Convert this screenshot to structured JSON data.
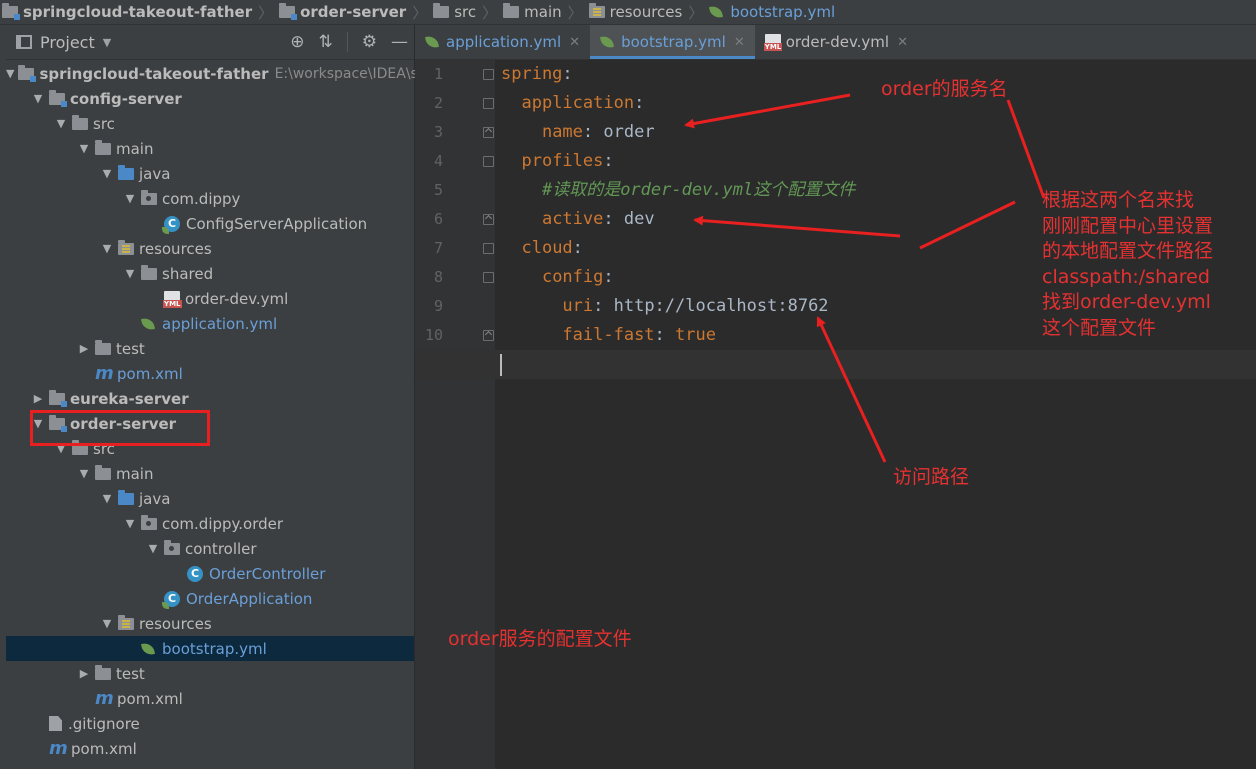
{
  "breadcrumb": [
    "springcloud-takeout-father",
    "order-server",
    "src",
    "main",
    "resources",
    "bootstrap.yml"
  ],
  "project_panel": {
    "title": "Project",
    "tree": [
      {
        "label": "springcloud-takeout-father",
        "extra": "E:\\workspace\\IDEA\\s",
        "level": 0,
        "expanded": true,
        "icon": "module-folder-icon",
        "bold": true
      },
      {
        "label": "config-server",
        "level": 1,
        "expanded": true,
        "icon": "module-folder-icon",
        "bold": true
      },
      {
        "label": "src",
        "level": 2,
        "expanded": true,
        "icon": "folder-icon"
      },
      {
        "label": "main",
        "level": 3,
        "expanded": true,
        "icon": "folder-icon"
      },
      {
        "label": "java",
        "level": 4,
        "expanded": true,
        "icon": "source-folder-icon"
      },
      {
        "label": "com.dippy",
        "level": 5,
        "expanded": true,
        "icon": "package-icon"
      },
      {
        "label": "ConfigServerApplication",
        "level": 6,
        "icon": "spring-boot-class-icon"
      },
      {
        "label": "resources",
        "level": 4,
        "expanded": true,
        "icon": "resources-folder-icon"
      },
      {
        "label": "shared",
        "level": 5,
        "expanded": true,
        "icon": "folder-icon"
      },
      {
        "label": "order-dev.yml",
        "level": 6,
        "icon": "yml-file-icon"
      },
      {
        "label": "application.yml",
        "level": 5,
        "icon": "spring-yml-icon",
        "blue": true
      },
      {
        "label": "test",
        "level": 3,
        "expanded": false,
        "icon": "folder-icon"
      },
      {
        "label": "pom.xml",
        "level": 3,
        "icon": "maven-icon",
        "blue": true
      },
      {
        "label": "eureka-server",
        "level": 1,
        "expanded": false,
        "icon": "module-folder-icon",
        "bold": true
      },
      {
        "label": "order-server",
        "level": 1,
        "expanded": true,
        "icon": "module-folder-icon",
        "bold": true
      },
      {
        "label": "src",
        "level": 2,
        "expanded": true,
        "icon": "folder-icon"
      },
      {
        "label": "main",
        "level": 3,
        "expanded": true,
        "icon": "folder-icon"
      },
      {
        "label": "java",
        "level": 4,
        "expanded": true,
        "icon": "source-folder-icon"
      },
      {
        "label": "com.dippy.order",
        "level": 5,
        "expanded": true,
        "icon": "package-icon"
      },
      {
        "label": "controller",
        "level": 6,
        "expanded": true,
        "icon": "package-icon"
      },
      {
        "label": "OrderController",
        "level": 7,
        "icon": "class-icon",
        "blue": true
      },
      {
        "label": "OrderApplication",
        "level": 6,
        "icon": "spring-boot-class-icon",
        "blue": true
      },
      {
        "label": "resources",
        "level": 4,
        "expanded": true,
        "icon": "resources-folder-icon"
      },
      {
        "label": "bootstrap.yml",
        "level": 5,
        "icon": "spring-yml-icon",
        "blue": true,
        "selected": true
      },
      {
        "label": "test",
        "level": 3,
        "expanded": false,
        "icon": "folder-icon"
      },
      {
        "label": "pom.xml",
        "level": 3,
        "icon": "maven-icon"
      },
      {
        "label": ".gitignore",
        "level": 1,
        "icon": "text-file-icon"
      },
      {
        "label": "pom.xml",
        "level": 1,
        "icon": "maven-icon"
      }
    ]
  },
  "tabs": [
    {
      "label": "application.yml",
      "icon": "spring-yml-icon",
      "active": false
    },
    {
      "label": "bootstrap.yml",
      "icon": "spring-yml-icon",
      "active": true
    },
    {
      "label": "order-dev.yml",
      "icon": "yml-file-icon",
      "active": false
    }
  ],
  "editor": {
    "lines": [
      {
        "n": "1",
        "parts": [
          [
            "k",
            "spring"
          ],
          [
            "v",
            ":"
          ]
        ]
      },
      {
        "n": "2",
        "parts": [
          [
            "v",
            "  "
          ],
          [
            "k",
            "application"
          ],
          [
            "v",
            ":"
          ]
        ]
      },
      {
        "n": "3",
        "parts": [
          [
            "v",
            "    "
          ],
          [
            "k",
            "name"
          ],
          [
            "v",
            ": order"
          ]
        ]
      },
      {
        "n": "4",
        "parts": [
          [
            "v",
            "  "
          ],
          [
            "k",
            "profiles"
          ],
          [
            "v",
            ":"
          ]
        ]
      },
      {
        "n": "5",
        "parts": [
          [
            "v",
            "    "
          ],
          [
            "c",
            "#读取的是order-dev.yml这个配置文件"
          ]
        ]
      },
      {
        "n": "6",
        "parts": [
          [
            "v",
            "    "
          ],
          [
            "k",
            "active"
          ],
          [
            "v",
            ": dev"
          ]
        ]
      },
      {
        "n": "7",
        "parts": [
          [
            "v",
            "  "
          ],
          [
            "k",
            "cloud"
          ],
          [
            "v",
            ":"
          ]
        ]
      },
      {
        "n": "8",
        "parts": [
          [
            "v",
            "    "
          ],
          [
            "k",
            "config"
          ],
          [
            "v",
            ":"
          ]
        ]
      },
      {
        "n": "9",
        "parts": [
          [
            "v",
            "      "
          ],
          [
            "k",
            "uri"
          ],
          [
            "v",
            ": http://localhost:8762"
          ]
        ]
      },
      {
        "n": "10",
        "parts": [
          [
            "v",
            "      "
          ],
          [
            "k",
            "fail-fast"
          ],
          [
            "v",
            ": "
          ],
          [
            "k",
            "true"
          ]
        ]
      },
      {
        "n": "11",
        "parts": []
      }
    ]
  },
  "annotations": {
    "service_name": "order的服务名",
    "lookup_lines": [
      "根据这两个名来找",
      "刚刚配置中心里设置",
      "的本地配置文件路径",
      "classpath:/shared",
      "找到order-dev.yml",
      "这个配置文件"
    ],
    "access_path": "访问路径",
    "config_file": "order服务的配置文件",
    "color": "#e53131"
  }
}
